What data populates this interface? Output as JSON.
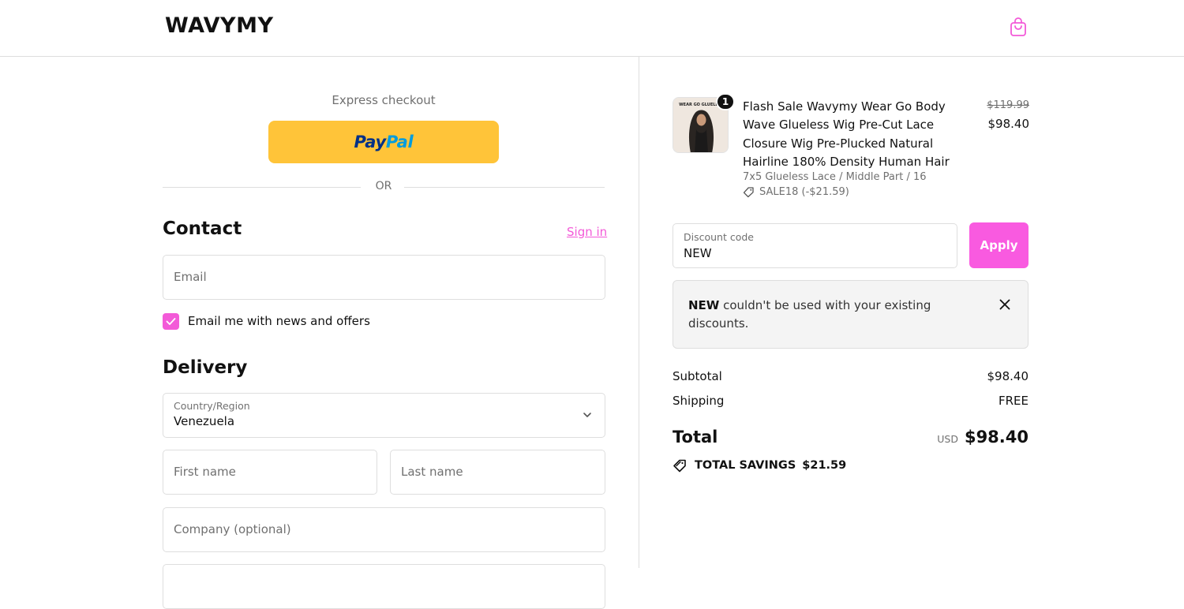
{
  "header": {
    "logo": "WAVYMY",
    "cart_icon": "shopping-bag-icon"
  },
  "express": {
    "label": "Express checkout",
    "paypal_part1": "Pay",
    "paypal_part2": "Pal",
    "or_text": "OR"
  },
  "contact": {
    "title": "Contact",
    "sign_in": "Sign in",
    "email_placeholder": "Email",
    "newsletter_label": "Email me with news and offers",
    "newsletter_checked": true
  },
  "delivery": {
    "title": "Delivery",
    "country_label": "Country/Region",
    "country_value": "Venezuela",
    "first_name_placeholder": "First name",
    "last_name_placeholder": "Last name",
    "company_placeholder": "Company (optional)"
  },
  "order": {
    "product": {
      "quantity": "1",
      "title": "Flash Sale Wavymy Wear Go Body Wave Glueless Wig Pre-Cut Lace Closure Wig Pre-Plucked Natural Hairline 180% Density Human Hair",
      "variant": "7x5 Glueless Lace / Middle Part / 16",
      "discount": "SALE18 (-$21.59)",
      "original_price": "$119.99",
      "price": "$98.40",
      "thumb_text": "WEAR GO GLUELESS"
    },
    "discount_code": {
      "label": "Discount code",
      "value": "NEW",
      "apply_label": "Apply"
    },
    "error": {
      "code": "NEW",
      "message": " couldn't be used with your existing discounts."
    },
    "subtotal_label": "Subtotal",
    "subtotal_value": "$98.40",
    "shipping_label": "Shipping",
    "shipping_value": "FREE",
    "total_label": "Total",
    "currency": "USD",
    "total_value": "$98.40",
    "savings_label": "TOTAL SAVINGS",
    "savings_value": "$21.59"
  },
  "colors": {
    "accent": "#f35ad8",
    "apply_button": "#f95ae0",
    "paypal_yellow": "#ffc439",
    "paypal_dark": "#003087",
    "paypal_light": "#009cde"
  }
}
